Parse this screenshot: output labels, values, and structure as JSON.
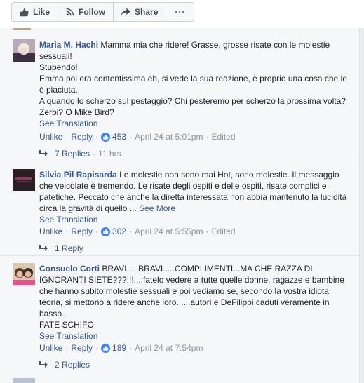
{
  "toolbar": {
    "like": "Like",
    "follow": "Follow",
    "share": "Share",
    "more": "···"
  },
  "comments": [
    {
      "author": "Maria M. Hachi",
      "line1": "Mamma mia che ridere! Grasse, grosse risate con le molestie sessuali!",
      "line2": "Stupendo!",
      "line3": "Emma poi era contentissima eh, si vede la sua reazione, è proprio una cosa che le è piaciuta.",
      "line4": "A quando lo scherzo sul pestaggio? Chi pesteremo per scherzo la prossima volta? Zerbi? O Mike Bird?",
      "see_translation": "See Translation",
      "unlike": "Unlike",
      "reply": "Reply",
      "like_count": "453",
      "timestamp": "April 24 at 5:01pm",
      "edited": "Edited",
      "replies_label": "7 Replies",
      "replies_age": "11 hrs"
    },
    {
      "author": "Silvia Pil Rapisarda",
      "text": "Le molestie non sono mai Hot, sono molestie. Il messaggio che veicolate è tremendo. Le risate degli ospiti e delle ospiti, risate complici e patetiche. Peccato che anche la diretta interessata non abbia mantenuto la lucidità circa la gravità di quello ...",
      "see_more": "See More",
      "see_translation": "See Translation",
      "unlike": "Unlike",
      "reply": "Reply",
      "like_count": "302",
      "timestamp": "April 24 at 5:55pm",
      "edited": "Edited",
      "replies_label": "1 Reply"
    },
    {
      "author": "Consuelo Corti",
      "text": "BRAVI.....BRAVI.....COMPLIMENTI...MA CHE RAZZA DI IGNORANTI SIETE???!!!....fatelo vedere a tutte quelle donne, ragazze e bambine che hanno subito molestie sessuali e poi vediamo se, secondo la vostra idiota teoria, si mettono a ridere anche loro. ....autori e DeFilippi caduti veramente in basso.",
      "line2": "FATE SCHIFO",
      "see_translation": "See Translation",
      "unlike": "Unlike",
      "reply": "Reply",
      "like_count": "189",
      "timestamp": "April 24 at 7:54pm",
      "replies_label": "2 Replies"
    }
  ],
  "colors": {
    "link": "#365899",
    "meta": "#90949c",
    "text": "#1d2129"
  },
  "icons": {
    "like": "thumbs-up-icon",
    "follow": "rss-icon",
    "share": "share-arrow-icon",
    "reply": "reply-arrow-icon"
  }
}
